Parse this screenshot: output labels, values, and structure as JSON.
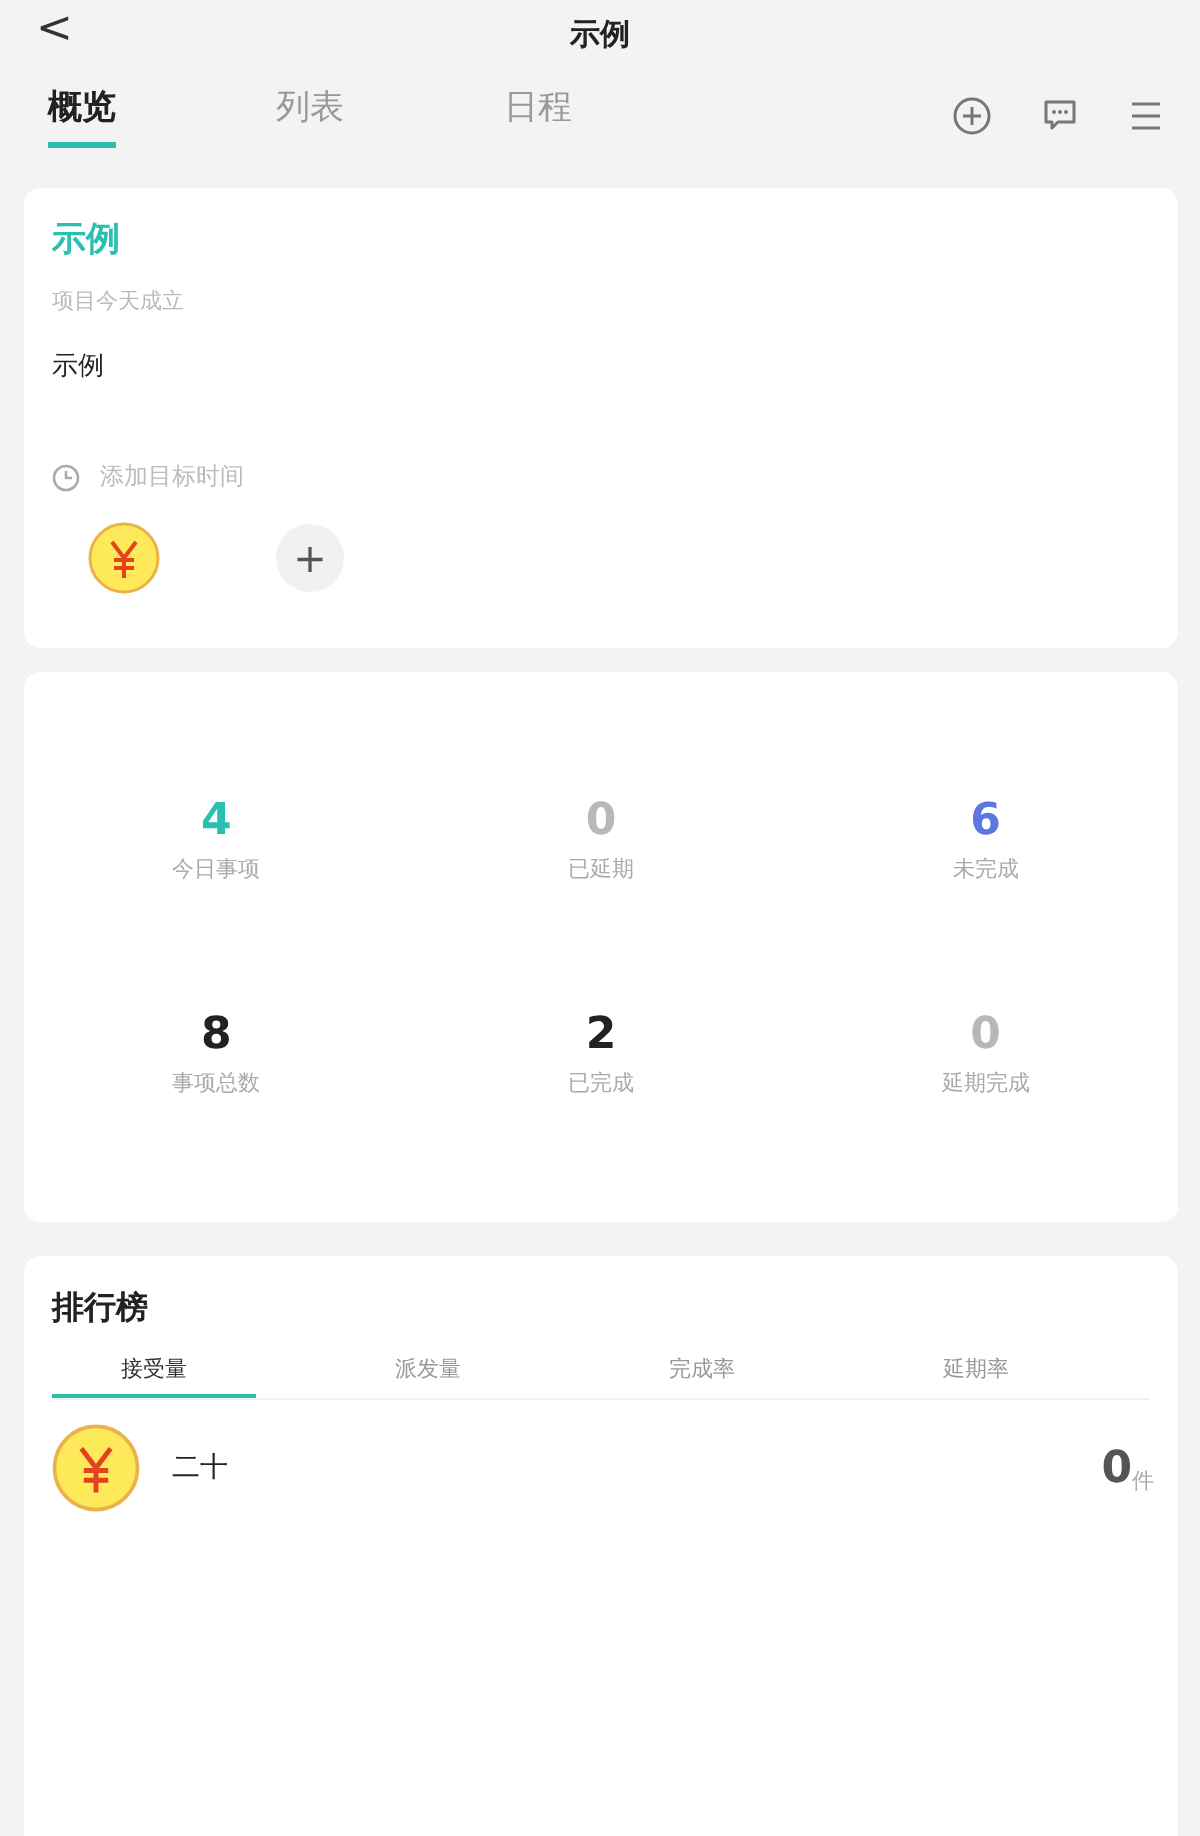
{
  "header": {
    "back": "<",
    "title": "示例"
  },
  "tabs": [
    {
      "label": "概览",
      "selected": true
    },
    {
      "label": "列表",
      "selected": false
    },
    {
      "label": "日程",
      "selected": false
    }
  ],
  "project": {
    "name": "示例",
    "subtitle": "项目今天成立",
    "description": "示例",
    "target_time": "添加目标时间",
    "add": "+"
  },
  "stats": [
    {
      "value": "4",
      "label": "今日事项",
      "color": "#2bbfb0"
    },
    {
      "value": "0",
      "label": "已延期",
      "color": "#b8b8b8"
    },
    {
      "value": "6",
      "label": "未完成",
      "color": "#5b78e0"
    },
    {
      "value": "8",
      "label": "事项总数",
      "color": "#222222"
    },
    {
      "value": "2",
      "label": "已完成",
      "color": "#222222"
    },
    {
      "value": "0",
      "label": "延期完成",
      "color": "#b8b8b8"
    }
  ],
  "ranking": {
    "title": "排行榜",
    "tabs": [
      {
        "label": "接受量",
        "selected": true
      },
      {
        "label": "派发量",
        "selected": false
      },
      {
        "label": "完成率",
        "selected": false
      },
      {
        "label": "延期率",
        "selected": false
      }
    ],
    "rows": [
      {
        "name": "二十",
        "count": "0",
        "unit": "件"
      }
    ]
  }
}
